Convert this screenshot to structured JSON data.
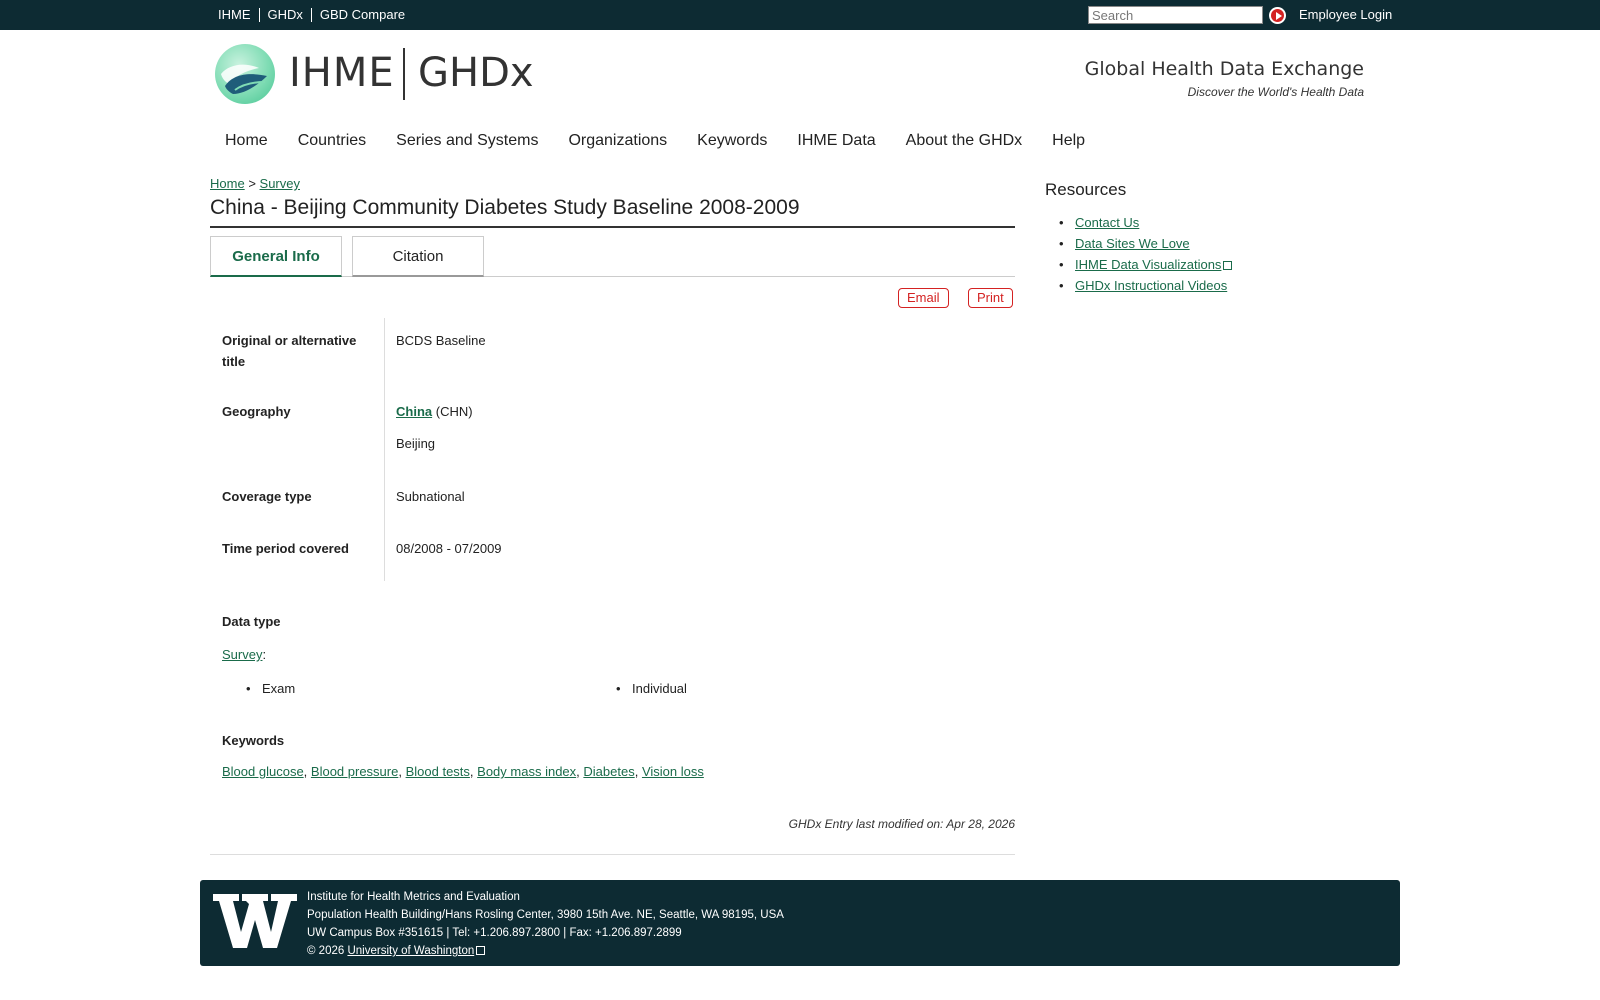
{
  "topbar": {
    "links": [
      "IHME",
      "GHDx",
      "GBD Compare"
    ],
    "search_placeholder": "Search",
    "login": "Employee Login"
  },
  "header": {
    "brand_ihme": "IHME",
    "brand_ghdx": "GHDx",
    "tagline": "Global Health Data Exchange",
    "subtagline": "Discover the World's Health Data"
  },
  "nav": [
    "Home",
    "Countries",
    "Series and Systems",
    "Organizations",
    "Keywords",
    "IHME Data",
    "About the GHDx",
    "Help"
  ],
  "breadcrumb": {
    "home": "Home",
    "sep": ">",
    "current": "Survey"
  },
  "page_title": "China - Beijing Community Diabetes Study Baseline 2008-2009",
  "tabs": {
    "general": "General Info",
    "citation": "Citation"
  },
  "actions": {
    "email": "Email",
    "print": "Print"
  },
  "details": {
    "alt_title_label": "Original or alternative title",
    "alt_title_value": "BCDS Baseline",
    "geo_label": "Geography",
    "geo_country": "China",
    "geo_code": "(CHN)",
    "geo_region": "Beijing",
    "coverage_label": "Coverage type",
    "coverage_value": "Subnational",
    "time_label": "Time period covered",
    "time_value": "08/2008 - 07/2009"
  },
  "data_type": {
    "label": "Data type",
    "link": "Survey",
    "items": [
      "Exam",
      "Individual"
    ]
  },
  "keywords": {
    "label": "Keywords",
    "items": [
      "Blood glucose",
      "Blood pressure",
      "Blood tests",
      "Body mass index",
      "Diabetes",
      "Vision loss"
    ]
  },
  "modified": "GHDx Entry last modified on: Apr 28, 2026",
  "resources": {
    "title": "Resources",
    "items": [
      "Contact Us",
      "Data Sites We Love",
      "IHME Data Visualizations",
      "GHDx Instructional Videos"
    ]
  },
  "footer": {
    "line1": "Institute for Health Metrics and Evaluation",
    "line2": "Population Health Building/Hans Rosling Center, 3980 15th Ave. NE, Seattle, WA 98195, USA",
    "line3": "UW Campus Box #351615 | Tel: +1.206.897.2800 | Fax: +1.206.897.2899",
    "copyright": "© 2026",
    "uw_link": "University of Washington"
  },
  "colors": {
    "dark": "#0d2b33",
    "link": "#1a6b4a",
    "accent_red": "#d42222"
  }
}
